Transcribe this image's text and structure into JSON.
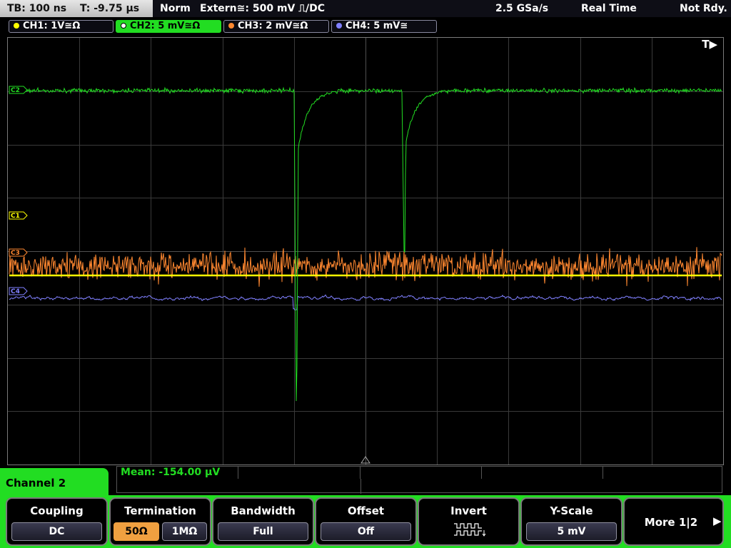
{
  "topbar": {
    "timebase": "TB: 100 ns",
    "trigger_time": "T: -9.75 µs",
    "mode": "Norm",
    "trigger_source": "Extern≅: 500 mV ⎍/DC",
    "sample_rate": "2.5 GSa/s",
    "acquisition": "Real Time",
    "status": "Not Rdy."
  },
  "channels": [
    {
      "label": "CH1: 1V≅Ω",
      "color": "#ffff00"
    },
    {
      "label": "CH2: 5 mV≅Ω",
      "color": "#22dd22"
    },
    {
      "label": "CH3: 2 mV≅Ω",
      "color": "#ff8830"
    },
    {
      "label": "CH4: 5 mV≅",
      "color": "#8080ff"
    }
  ],
  "trace_markers": {
    "c1": "C1",
    "c2": "C2",
    "c3": "C3",
    "c4": "C4"
  },
  "trigger_position_label": "T▶",
  "measurement": {
    "text": "Mean: -154.00 µV"
  },
  "panel": {
    "title": "Channel 2"
  },
  "softkeys": {
    "coupling": {
      "title": "Coupling",
      "value": "DC"
    },
    "termination": {
      "title": "Termination",
      "options": [
        "50Ω",
        "1MΩ"
      ],
      "selected": "50Ω"
    },
    "bandwidth": {
      "title": "Bandwidth",
      "value": "Full"
    },
    "offset": {
      "title": "Offset",
      "value": "Off"
    },
    "invert": {
      "title": "Invert",
      "icon": "square-wave-invert-icon"
    },
    "yscale": {
      "title": "Y-Scale",
      "value": "5 mV"
    },
    "more": {
      "label": "More 1|2"
    }
  }
}
